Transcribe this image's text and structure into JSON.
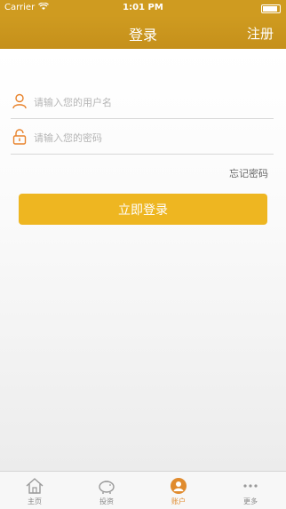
{
  "status_bar": {
    "carrier": "Carrier",
    "time": "1:01 PM"
  },
  "nav": {
    "title": "登录",
    "register_label": "注册"
  },
  "form": {
    "username_placeholder": "请输入您的用户名",
    "password_placeholder": "请输入您的密码",
    "forgot_label": "忘记密码",
    "login_label": "立即登录"
  },
  "tabs": [
    {
      "label": "主页",
      "icon": "home-icon"
    },
    {
      "label": "投资",
      "icon": "piggy-bank-icon"
    },
    {
      "label": "账户",
      "icon": "account-icon"
    },
    {
      "label": "更多",
      "icon": "more-icon"
    }
  ],
  "colors": {
    "nav": "#cf9b20",
    "button": "#eeb621",
    "accent": "#e08b2e"
  }
}
